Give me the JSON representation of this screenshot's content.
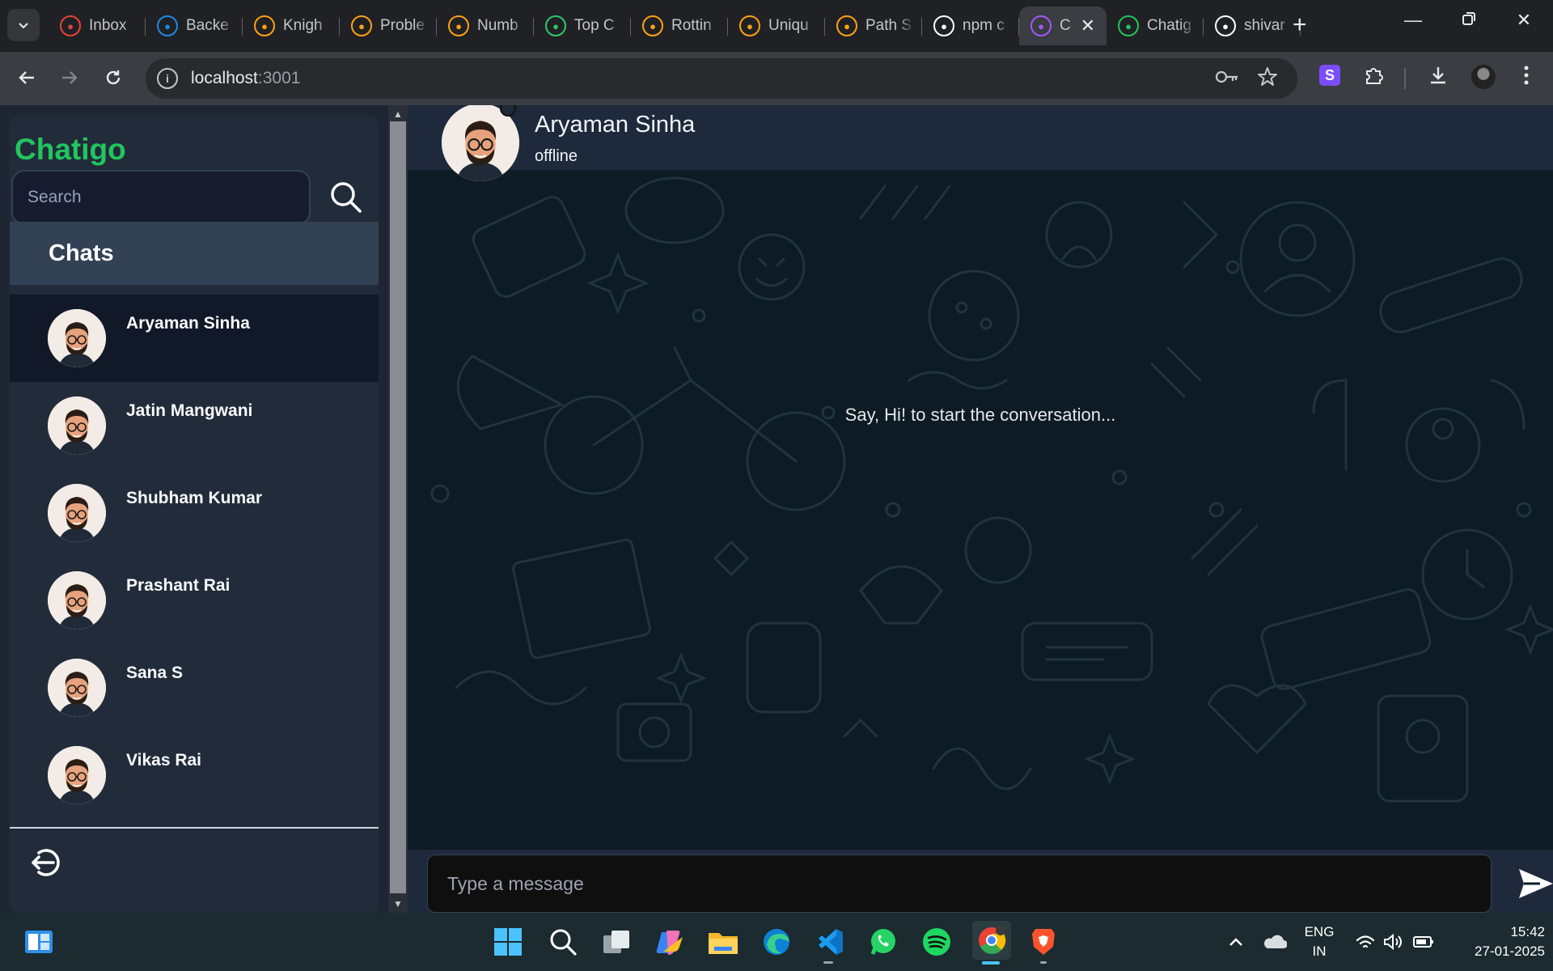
{
  "browser": {
    "tabs": [
      {
        "label": "Inbox",
        "icon": "gmail-icon",
        "color": "#ea4335"
      },
      {
        "label": "Backe",
        "icon": "is-icon",
        "color": "#1e88e5"
      },
      {
        "label": "Knigh",
        "icon": "leetcode-icon",
        "color": "#ffa116"
      },
      {
        "label": "Proble",
        "icon": "chart-icon",
        "color": "#ffa116"
      },
      {
        "label": "Numb",
        "icon": "leetcode-icon",
        "color": "#ffa116"
      },
      {
        "label": "Top C",
        "icon": "hackerrank-icon",
        "color": "#2ec866"
      },
      {
        "label": "Rottin",
        "icon": "leetcode-icon",
        "color": "#ffa116"
      },
      {
        "label": "Uniqu",
        "icon": "leetcode-icon",
        "color": "#ffa116"
      },
      {
        "label": "Path S",
        "icon": "leetcode-icon",
        "color": "#ffa116"
      },
      {
        "label": "npm c",
        "icon": "openai-icon",
        "color": "#ffffff"
      },
      {
        "label": "C",
        "icon": "vite-icon",
        "color": "#a855f7",
        "active": true
      },
      {
        "label": "Chatig",
        "icon": "mongodb-icon",
        "color": "#22c55e"
      },
      {
        "label": "shivar",
        "icon": "github-icon",
        "color": "#ffffff"
      }
    ],
    "url_host": "localhost",
    "url_port": ":3001"
  },
  "sidebar": {
    "brand": "Chatigo",
    "search_placeholder": "Search",
    "section_title": "Chats",
    "chats": [
      {
        "name": "Aryaman Sinha",
        "selected": true
      },
      {
        "name": "Jatin Mangwani"
      },
      {
        "name": "Shubham Kumar"
      },
      {
        "name": "Prashant Rai"
      },
      {
        "name": "Sana S"
      },
      {
        "name": "Vikas Rai"
      }
    ]
  },
  "conversation": {
    "contact_name": "Aryaman Sinha",
    "contact_status": "offline",
    "empty_message": "Say, Hi! to start the conversation...",
    "input_placeholder": "Type a message"
  },
  "taskbar": {
    "lang_line1": "ENG",
    "lang_line2": "IN",
    "time": "15:42",
    "date": "27-01-2025"
  },
  "colors": {
    "brand": "#22c55e",
    "sidebar_bg": "#222b3a",
    "chat_bg": "#0d1b24",
    "header_bg": "#1e293b"
  }
}
